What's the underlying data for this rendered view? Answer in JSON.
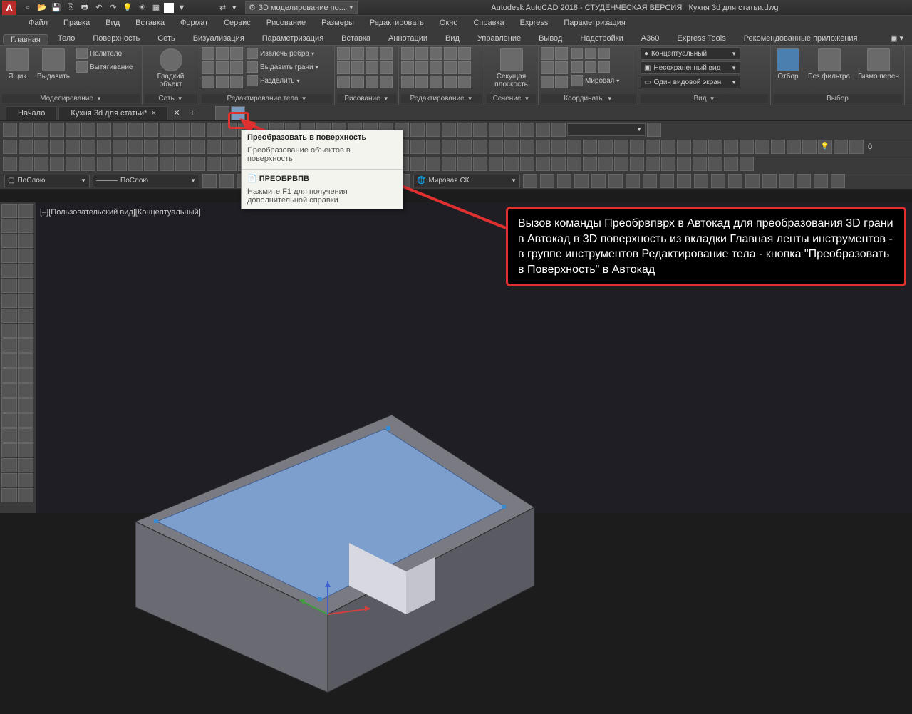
{
  "title": {
    "app": "Autodesk AutoCAD 2018 - СТУДЕНЧЕСКАЯ ВЕРСИЯ",
    "file": "Кухня 3d для статьи.dwg"
  },
  "workspace": "3D моделирование по...",
  "menu": [
    "Файл",
    "Правка",
    "Вид",
    "Вставка",
    "Формат",
    "Сервис",
    "Рисование",
    "Размеры",
    "Редактировать",
    "Окно",
    "Справка",
    "Express",
    "Параметризация"
  ],
  "ribbonTabs": [
    "Главная",
    "Тело",
    "Поверхность",
    "Сеть",
    "Визуализация",
    "Параметризация",
    "Вставка",
    "Аннотации",
    "Вид",
    "Управление",
    "Вывод",
    "Надстройки",
    "A360",
    "Express Tools",
    "Рекомендованные приложения"
  ],
  "ribbon": {
    "drawer": "Ящик",
    "extrude": "Выдавить",
    "polysolid": "Политело",
    "presspull": "Вытягивание",
    "smooth": "Гладкий объект",
    "extractEdges": "Извлечь ребра",
    "extrudeFaces": "Выдавить грани",
    "separate": "Разделить",
    "section": "Секущая плоскость",
    "world": "Мировая",
    "selection": "Отбор",
    "nofilter": "Без фильтра",
    "gizmo": "Гизмо перен",
    "visualStyle": "Концептуальный",
    "savedView": "Несохраненный вид",
    "viewport": "Один видовой экран",
    "panels": {
      "modeling": "Моделирование",
      "mesh": "Сеть",
      "solidEdit": "Редактирование тела",
      "draw": "Рисование",
      "modify": "Редактирование",
      "section": "Сечение",
      "coords": "Координаты",
      "view": "Вид",
      "select": "Выбор"
    }
  },
  "docTabs": {
    "start": "Начало",
    "file": "Кухня 3d для статьи*"
  },
  "layers": {
    "bylayer": "ПоСлою",
    "bylayer2": "ПоСлою",
    "wcs": "Мировая СК"
  },
  "tooltip": {
    "title": "Преобразовать в поверхность",
    "desc": "Преобразование объектов в поверхность",
    "cmd": "ПРЕОБРВПВ",
    "help": "Нажмите F1 для получения дополнительной справки"
  },
  "callout": "Вызов команды Преобрвпврх в Автокад для преобразования 3D грани в Автокад в 3D поверхность из вкладки Главная ленты инструментов - в группе инструментов Редактирование тела - кнопка \"Преобразовать в Поверхность\" в Автокад",
  "vpLabel": "[–][Пользовательский вид][Концептуальный]"
}
